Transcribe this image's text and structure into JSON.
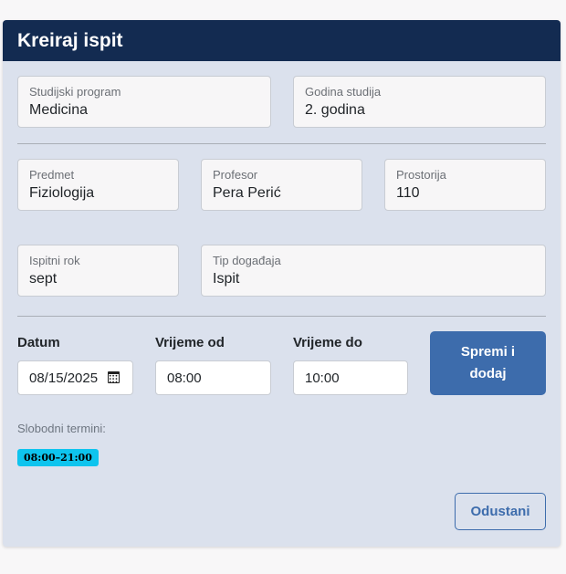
{
  "modal": {
    "title": "Kreiraj ispit"
  },
  "fields": {
    "program": {
      "label": "Studijski program",
      "value": "Medicina"
    },
    "year": {
      "label": "Godina studija",
      "value": "2. godina"
    },
    "subject": {
      "label": "Predmet",
      "value": "Fiziologija"
    },
    "professor": {
      "label": "Profesor",
      "value": "Pera Perić"
    },
    "room": {
      "label": "Prostorija",
      "value": "110"
    },
    "term": {
      "label": "Ispitni rok",
      "value": "sept"
    },
    "event_type": {
      "label": "Tip događaja",
      "value": "Ispit"
    }
  },
  "schedule": {
    "date_label": "Datum",
    "date_value": "08/15/2025",
    "from_label": "Vrijeme od",
    "from_value": "08:00",
    "to_label": "Vrijeme do",
    "to_value": "10:00"
  },
  "actions": {
    "save_add_line1": "Spremi i",
    "save_add_line2": "dodaj",
    "cancel": "Odustani"
  },
  "availability": {
    "label": "Slobodni termini:",
    "slots": [
      "08:00–21:00"
    ]
  },
  "colors": {
    "header_bg": "#132b51",
    "body_bg": "#dbe1ed",
    "primary": "#3d6cac",
    "slot_badge": "#0ec4ee"
  }
}
